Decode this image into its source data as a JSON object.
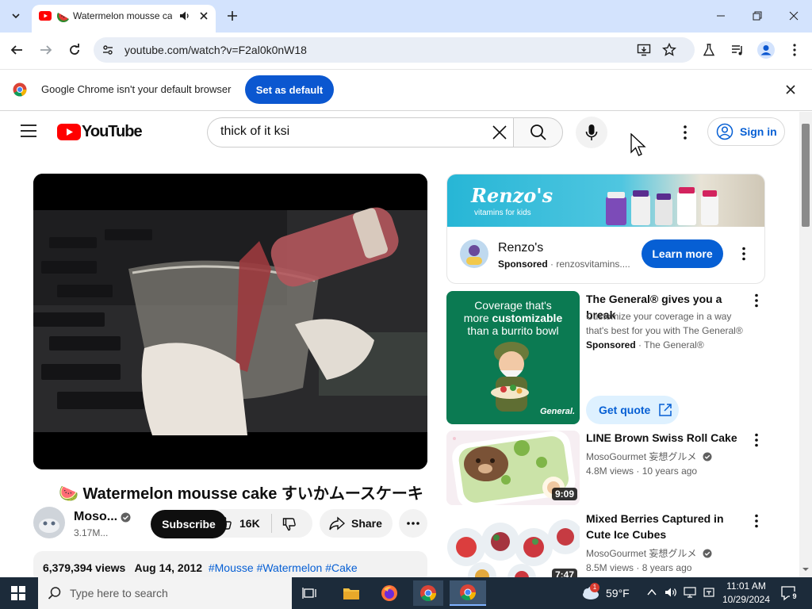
{
  "browser": {
    "tab_title": "Watermelon mousse cake",
    "url": "youtube.com/watch?v=F2al0k0nW18",
    "infobar_text": "Google Chrome isn't your default browser",
    "set_default_label": "Set as default"
  },
  "youtube": {
    "logo_text": "YouTube",
    "search_query": "thick of it ksi",
    "sign_in_label": "Sign in",
    "video": {
      "title": "🍉 Watermelon mousse cake すいかムースケーキ",
      "channel": "Moso...",
      "subscribers": "3.17M...",
      "subscribe_label": "Subscribe",
      "likes": "16K",
      "share_label": "Share",
      "views": "6,379,394 views",
      "date": "Aug 14, 2012",
      "hashtags": [
        "#Mousse",
        "#Watermelon",
        "#Cake"
      ]
    },
    "sidebar": {
      "ad1": {
        "brand": "Renzo's",
        "banner_brand": "Renzo's",
        "banner_tagline": "vitamins for kids",
        "sponsored": "Sponsored",
        "domain": "renzosvitamins....",
        "cta": "Learn more"
      },
      "ad2": {
        "title": "The General® gives you a break",
        "desc": "Customize your coverage in a way that's best for you with The General®",
        "sponsored": "Sponsored",
        "advertiser": "The General®",
        "cta": "Get quote",
        "thumb_line1": "Coverage that's",
        "thumb_line2_a": "more ",
        "thumb_line2_b": "customizable",
        "thumb_line3": "than a burrito bowl",
        "thumb_brand": "General."
      },
      "videos": [
        {
          "title": "LINE Brown Swiss Roll Cake",
          "channel": "MosoGourmet 妄想グルメ",
          "views": "4.8M views",
          "age": "10 years ago",
          "duration": "9:09"
        },
        {
          "title": "Mixed Berries Captured in Cute Ice Cubes",
          "channel": "MosoGourmet 妄想グルメ",
          "views": "8.5M views",
          "age": "8 years ago",
          "duration": "7:47"
        }
      ]
    }
  },
  "taskbar": {
    "search_placeholder": "Type here to search",
    "weather": "59°F",
    "weather_badge": "1",
    "time": "11:01 AM",
    "date": "10/29/2024",
    "notification_count": "9"
  }
}
